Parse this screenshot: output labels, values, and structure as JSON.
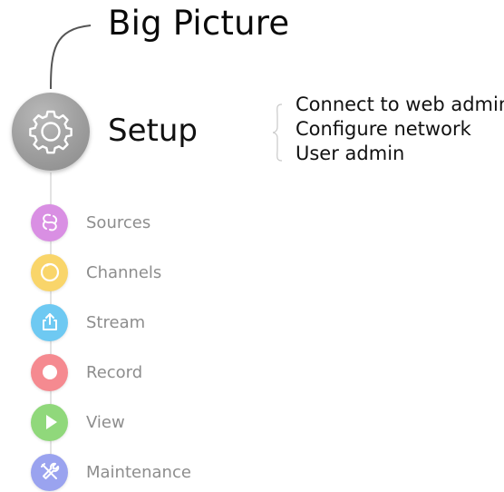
{
  "header": {
    "title": "Big Picture"
  },
  "setup": {
    "label": "Setup",
    "icon": "gear-icon",
    "submenu": [
      {
        "label": "Connect to web admin"
      },
      {
        "label": "Configure network"
      },
      {
        "label": "User admin"
      }
    ]
  },
  "nav": {
    "items": [
      {
        "label": "Sources",
        "icon": "link-icon",
        "color": "#d98fe3"
      },
      {
        "label": "Channels",
        "icon": "ring-icon",
        "color": "#f9d56a"
      },
      {
        "label": "Stream",
        "icon": "upload-icon",
        "color": "#6ec9f2"
      },
      {
        "label": "Record",
        "icon": "record-icon",
        "color": "#f58a90"
      },
      {
        "label": "View",
        "icon": "play-icon",
        "color": "#90d87b"
      },
      {
        "label": "Maintenance",
        "icon": "tools-icon",
        "color": "#9aa3ef"
      }
    ]
  }
}
